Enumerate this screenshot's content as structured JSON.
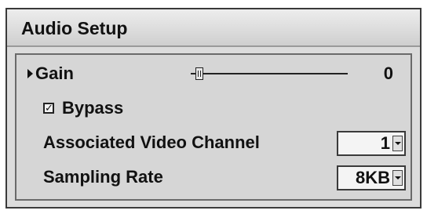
{
  "window": {
    "title": "Audio Setup"
  },
  "gain": {
    "label": "Gain",
    "value": "0",
    "slider_fraction": 0.03
  },
  "bypass": {
    "label": "Bypass",
    "checked": true,
    "check_glyph": "✓"
  },
  "associated_video_channel": {
    "label": "Associated Video Channel",
    "value": "1"
  },
  "sampling_rate": {
    "label": "Sampling Rate",
    "value": "8KB"
  },
  "icons": {
    "selection_indicator": "caret-right-icon",
    "dropdown": "chevron-down-icon"
  },
  "colors": {
    "background": "#dcdcdc",
    "border": "#3a3a3a",
    "text": "#111111"
  }
}
